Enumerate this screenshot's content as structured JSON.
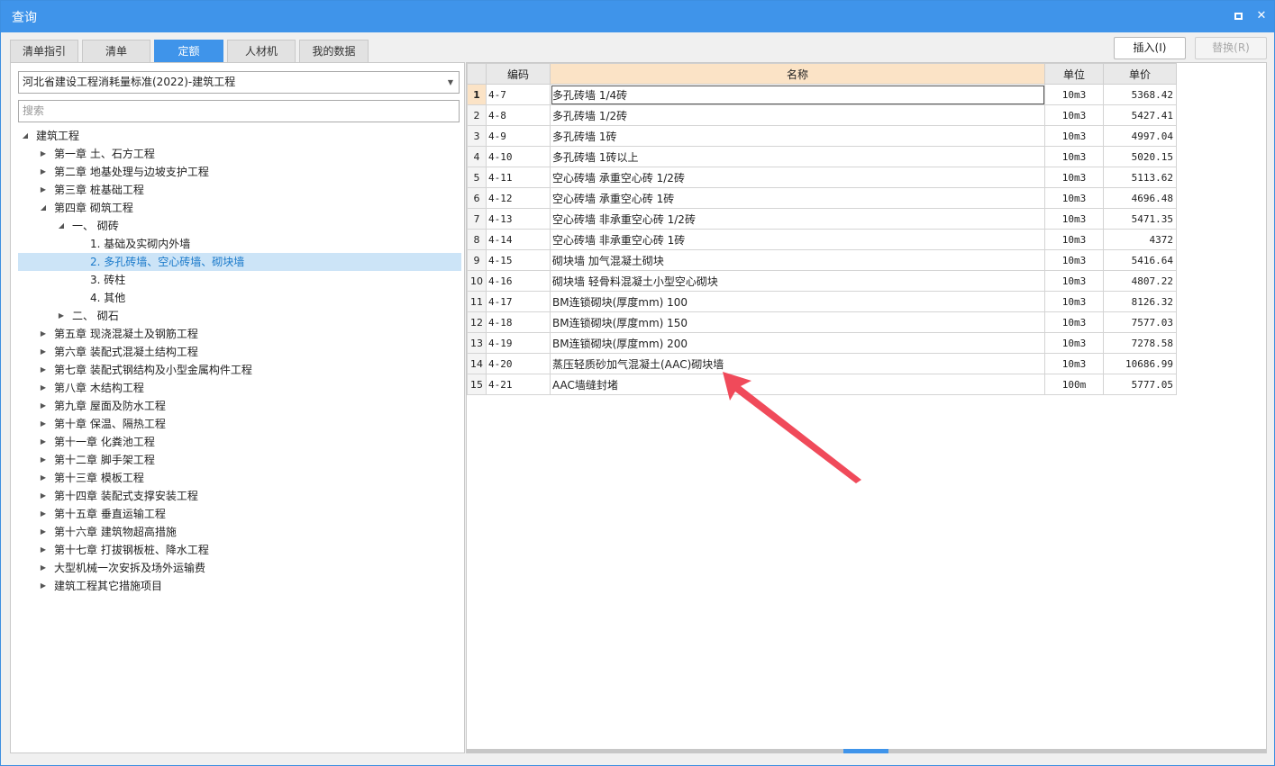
{
  "window": {
    "title": "查询"
  },
  "tabs": [
    "清单指引",
    "清单",
    "定额",
    "人材机",
    "我的数据"
  ],
  "actions": {
    "insert": "插入(I)",
    "replace": "替换(R)"
  },
  "left": {
    "library": "河北省建设工程消耗量标准(2022)-建筑工程",
    "search_placeholder": "搜索",
    "tree": [
      {
        "label": "建筑工程",
        "level": 0,
        "toggle": "expanded"
      },
      {
        "label": "第一章 土、石方工程",
        "level": 1,
        "toggle": "collapsed"
      },
      {
        "label": "第二章 地基处理与边坡支护工程",
        "level": 1,
        "toggle": "collapsed"
      },
      {
        "label": "第三章 桩基础工程",
        "level": 1,
        "toggle": "collapsed"
      },
      {
        "label": "第四章 砌筑工程",
        "level": 1,
        "toggle": "expanded"
      },
      {
        "label": "一、 砌砖",
        "level": 2,
        "toggle": "expanded"
      },
      {
        "label": "1. 基础及实砌内外墙",
        "level": 3,
        "toggle": "none"
      },
      {
        "label": "2. 多孔砖墙、空心砖墙、砌块墙",
        "level": 3,
        "toggle": "none",
        "selected": true
      },
      {
        "label": "3. 砖柱",
        "level": 3,
        "toggle": "none"
      },
      {
        "label": "4. 其他",
        "level": 3,
        "toggle": "none"
      },
      {
        "label": "二、 砌石",
        "level": 2,
        "toggle": "collapsed"
      },
      {
        "label": "第五章 现浇混凝土及钢筋工程",
        "level": 1,
        "toggle": "collapsed"
      },
      {
        "label": "第六章 装配式混凝土结构工程",
        "level": 1,
        "toggle": "collapsed"
      },
      {
        "label": "第七章 装配式钢结构及小型金属构件工程",
        "level": 1,
        "toggle": "collapsed"
      },
      {
        "label": "第八章 木结构工程",
        "level": 1,
        "toggle": "collapsed"
      },
      {
        "label": "第九章 屋面及防水工程",
        "level": 1,
        "toggle": "collapsed"
      },
      {
        "label": "第十章 保温、隔热工程",
        "level": 1,
        "toggle": "collapsed"
      },
      {
        "label": "第十一章 化粪池工程",
        "level": 1,
        "toggle": "collapsed"
      },
      {
        "label": "第十二章 脚手架工程",
        "level": 1,
        "toggle": "collapsed"
      },
      {
        "label": "第十三章 模板工程",
        "level": 1,
        "toggle": "collapsed"
      },
      {
        "label": "第十四章 装配式支撑安装工程",
        "level": 1,
        "toggle": "collapsed"
      },
      {
        "label": "第十五章 垂直运输工程",
        "level": 1,
        "toggle": "collapsed"
      },
      {
        "label": "第十六章 建筑物超高措施",
        "level": 1,
        "toggle": "collapsed"
      },
      {
        "label": "第十七章 打拔钢板桩、降水工程",
        "level": 1,
        "toggle": "collapsed"
      },
      {
        "label": "大型机械一次安拆及场外运输费",
        "level": 1,
        "toggle": "collapsed"
      },
      {
        "label": "建筑工程其它措施项目",
        "level": 1,
        "toggle": "collapsed"
      }
    ]
  },
  "grid": {
    "headers": {
      "code": "编码",
      "name": "名称",
      "unit": "单位",
      "price": "单价"
    },
    "rows": [
      {
        "n": "1",
        "code": "4-7",
        "name": "多孔砖墙 1/4砖",
        "unit": "10m3",
        "price": "5368.42"
      },
      {
        "n": "2",
        "code": "4-8",
        "name": "多孔砖墙 1/2砖",
        "unit": "10m3",
        "price": "5427.41"
      },
      {
        "n": "3",
        "code": "4-9",
        "name": "多孔砖墙 1砖",
        "unit": "10m3",
        "price": "4997.04"
      },
      {
        "n": "4",
        "code": "4-10",
        "name": "多孔砖墙 1砖以上",
        "unit": "10m3",
        "price": "5020.15"
      },
      {
        "n": "5",
        "code": "4-11",
        "name": "空心砖墙 承重空心砖 1/2砖",
        "unit": "10m3",
        "price": "5113.62"
      },
      {
        "n": "6",
        "code": "4-12",
        "name": "空心砖墙 承重空心砖 1砖",
        "unit": "10m3",
        "price": "4696.48"
      },
      {
        "n": "7",
        "code": "4-13",
        "name": "空心砖墙 非承重空心砖 1/2砖",
        "unit": "10m3",
        "price": "5471.35"
      },
      {
        "n": "8",
        "code": "4-14",
        "name": "空心砖墙 非承重空心砖 1砖",
        "unit": "10m3",
        "price": "4372"
      },
      {
        "n": "9",
        "code": "4-15",
        "name": "砌块墙 加气混凝土砌块",
        "unit": "10m3",
        "price": "5416.64"
      },
      {
        "n": "10",
        "code": "4-16",
        "name": "砌块墙 轻骨料混凝土小型空心砌块",
        "unit": "10m3",
        "price": "4807.22"
      },
      {
        "n": "11",
        "code": "4-17",
        "name": "BM连锁砌块(厚度mm) 100",
        "unit": "10m3",
        "price": "8126.32"
      },
      {
        "n": "12",
        "code": "4-18",
        "name": "BM连锁砌块(厚度mm) 150",
        "unit": "10m3",
        "price": "7577.03"
      },
      {
        "n": "13",
        "code": "4-19",
        "name": "BM连锁砌块(厚度mm) 200",
        "unit": "10m3",
        "price": "7278.58"
      },
      {
        "n": "14",
        "code": "4-20",
        "name": "蒸压轻质砂加气混凝土(AAC)砌块墙",
        "unit": "10m3",
        "price": "10686.99"
      },
      {
        "n": "15",
        "code": "4-21",
        "name": "AAC墙缝封堵",
        "unit": "100m",
        "price": "5777.05"
      }
    ]
  },
  "colors": {
    "accent": "#3f94ea",
    "annotation": "#f04a5a"
  }
}
